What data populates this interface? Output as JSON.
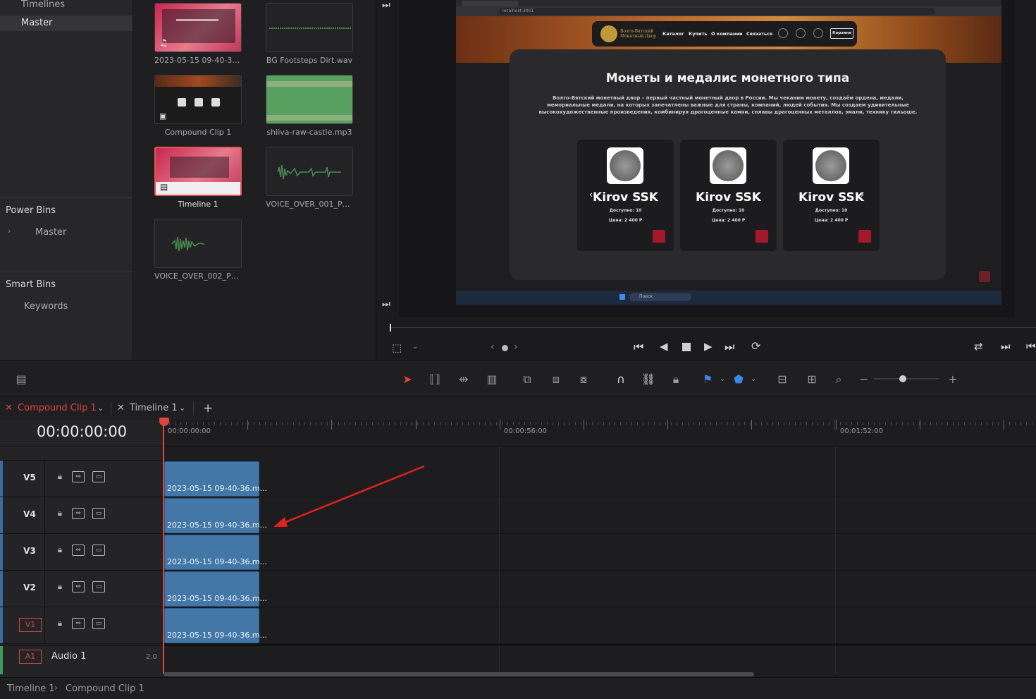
{
  "bins": {
    "timelines": "Timelines",
    "master": "Master",
    "power_bins": "Power Bins",
    "power_master": "Master",
    "smart_bins": "Smart Bins",
    "keywords": "Keywords"
  },
  "pool": {
    "clips": [
      {
        "name": "2023-05-15 09-40-36....",
        "kind": "video"
      },
      {
        "name": "BG Footsteps Dirt.wav",
        "kind": "audio"
      },
      {
        "name": "Compound Clip 1",
        "kind": "compound"
      },
      {
        "name": "shiiva-raw-castle.mp3",
        "kind": "audio-full"
      },
      {
        "name": "Timeline 1",
        "kind": "timeline"
      },
      {
        "name": "VOICE_OVER_001_PW...",
        "kind": "audio"
      },
      {
        "name": "VOICE_OVER_002_PW...",
        "kind": "audio"
      }
    ]
  },
  "site": {
    "brand_line1": "Волго-Вятский",
    "brand_line2": "Монетный Двор",
    "nav": [
      "Каталог",
      "Купить",
      "О компании",
      "Связаться"
    ],
    "cart": "Корзина",
    "title": "Монеты и медалис монетного типа",
    "description": "Волго-Вятский монетный двор – первый частный монетный двор в России. Мы чеканим монету, создаём ордена, медали, мемориальные медали, на которых запечатлены важные для страны, компаний, людей события. Мы создаем удивительные высокохудожественные произведения, комбинируя драгоценные камни, сплавы драгоценных металлов, эмали, технику гильоше.",
    "cards": [
      {
        "title": "Kirov SSK",
        "avail": "Доступно: 10",
        "price": "Цена: 2 400 Р"
      },
      {
        "title": "Kirov SSK",
        "avail": "Доступно: 10",
        "price": "Цена: 2 400 Р"
      },
      {
        "title": "Kirov SSK",
        "avail": "Доступно: 10",
        "price": "Цена: 2 400 Р"
      }
    ],
    "address": "localhost:3001",
    "search": "Поиск"
  },
  "tabs": {
    "tab1": "Compound Clip 1",
    "tab2": "Timeline 1"
  },
  "timeline": {
    "timecode": "00:00:00:00",
    "ruler": [
      "00:00:00:00",
      "00:00:56:00",
      "00:01:52:00"
    ],
    "tracks": [
      "V5",
      "V4",
      "V3",
      "V2",
      "V1"
    ],
    "clip_label": "2023-05-15 09-40-36.m...",
    "audio_track": "A1",
    "audio_name": "Audio 1",
    "audio_ch": "2.0"
  },
  "status": {
    "crumb1": "Timeline 1",
    "crumb2": "Compound Clip 1"
  },
  "colors": {
    "accent_red": "#e0443b",
    "clip_blue": "#4377a8",
    "site_red": "#a3182a"
  }
}
